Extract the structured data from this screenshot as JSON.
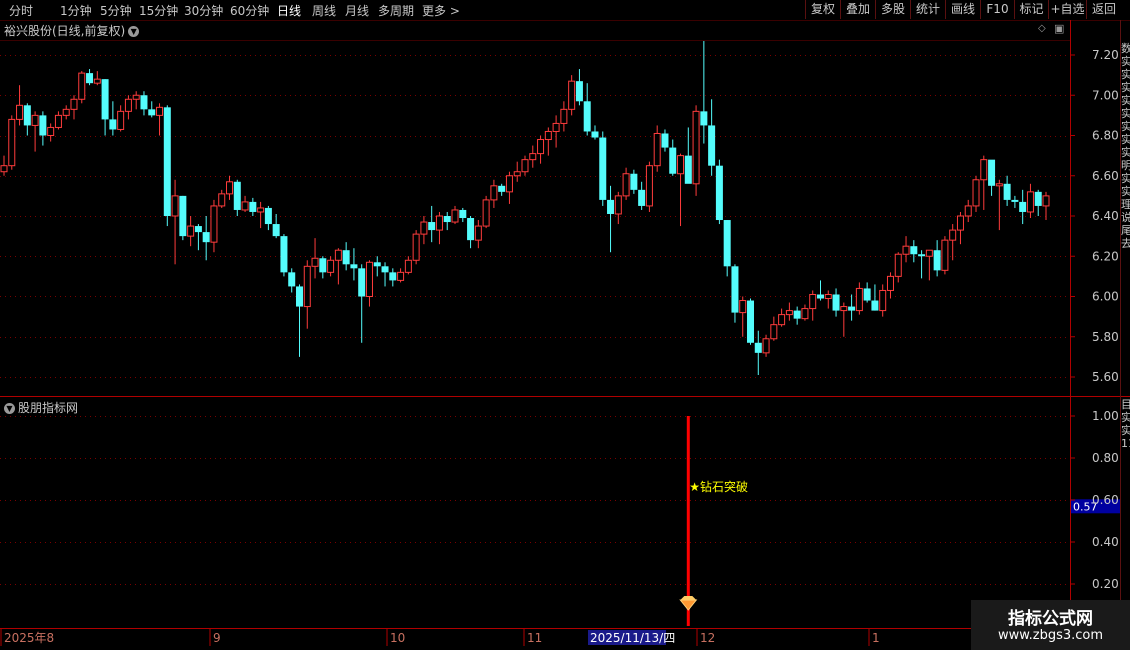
{
  "toolbar": {
    "periods": [
      "分时",
      "1分钟",
      "5分钟",
      "15分钟",
      "30分钟",
      "60分钟",
      "日线",
      "周线",
      "月线",
      "多周期",
      "更多"
    ],
    "active_period": "日线",
    "more_chevron": "chevron-right-icon",
    "buttons": [
      "复权",
      "叠加",
      "多股",
      "统计",
      "画线",
      "F10",
      "标记",
      "+自选",
      "返回"
    ]
  },
  "stock_title": "裕兴股份(日线,前复权)",
  "indicator_title": "股朋指标网",
  "current_value": "0.57",
  "signal_label": "★钻石突破",
  "date_labels": [
    "2025年8",
    "9",
    "10",
    "11",
    "2025/11/13/四",
    "12",
    "1"
  ],
  "right_column_glyphs": "数实实实实实实实实明实实理说尾去",
  "right_column_glyphs_lower": "目实实1111",
  "watermark": {
    "line1": "指标公式网",
    "line2": "www.zbgs3.com"
  },
  "colors": {
    "up": "#ff3c3c",
    "down": "#54fcfc",
    "grid": "#7a0000",
    "signal": "#ff0000",
    "label": "#ffff00",
    "value_box": "#0000a0"
  },
  "chart_data": [
    {
      "type": "candlestick",
      "title": "裕兴股份(日线,前复权)",
      "y_ticks": [
        "7.20",
        "7.00",
        "6.80",
        "6.60",
        "6.40",
        "6.20",
        "6.00",
        "5.80",
        "5.60"
      ],
      "ylim": [
        5.55,
        7.28
      ],
      "grid": true,
      "ohlc": [
        [
          6.62,
          6.7,
          6.6,
          6.65
        ],
        [
          6.65,
          6.9,
          6.63,
          6.88
        ],
        [
          6.88,
          7.05,
          6.85,
          6.95
        ],
        [
          6.95,
          6.96,
          6.8,
          6.85
        ],
        [
          6.85,
          6.92,
          6.72,
          6.9
        ],
        [
          6.9,
          6.92,
          6.75,
          6.8
        ],
        [
          6.8,
          6.86,
          6.77,
          6.84
        ],
        [
          6.84,
          6.92,
          6.83,
          6.9
        ],
        [
          6.9,
          6.95,
          6.88,
          6.93
        ],
        [
          6.93,
          7.0,
          6.88,
          6.98
        ],
        [
          6.98,
          7.12,
          6.96,
          7.11
        ],
        [
          7.11,
          7.13,
          7.05,
          7.06
        ],
        [
          7.06,
          7.12,
          7.05,
          7.08
        ],
        [
          7.08,
          7.08,
          6.8,
          6.88
        ],
        [
          6.88,
          6.97,
          6.8,
          6.83
        ],
        [
          6.83,
          6.95,
          6.82,
          6.92
        ],
        [
          6.92,
          7.0,
          6.88,
          6.98
        ],
        [
          6.98,
          7.02,
          6.93,
          7.0
        ],
        [
          7.0,
          7.02,
          6.9,
          6.93
        ],
        [
          6.93,
          6.97,
          6.89,
          6.9
        ],
        [
          6.9,
          6.96,
          6.8,
          6.94
        ],
        [
          6.94,
          6.95,
          6.35,
          6.4
        ],
        [
          6.4,
          6.58,
          6.16,
          6.5
        ],
        [
          6.5,
          6.5,
          6.28,
          6.3
        ],
        [
          6.3,
          6.4,
          6.25,
          6.35
        ],
        [
          6.35,
          6.36,
          6.23,
          6.32
        ],
        [
          6.32,
          6.4,
          6.18,
          6.27
        ],
        [
          6.27,
          6.48,
          6.22,
          6.45
        ],
        [
          6.45,
          6.53,
          6.44,
          6.51
        ],
        [
          6.51,
          6.6,
          6.48,
          6.57
        ],
        [
          6.57,
          6.58,
          6.4,
          6.43
        ],
        [
          6.43,
          6.5,
          6.42,
          6.47
        ],
        [
          6.47,
          6.49,
          6.4,
          6.42
        ],
        [
          6.42,
          6.47,
          6.34,
          6.44
        ],
        [
          6.44,
          6.45,
          6.33,
          6.36
        ],
        [
          6.36,
          6.41,
          6.29,
          6.3
        ],
        [
          6.3,
          6.31,
          6.1,
          6.12
        ],
        [
          6.12,
          6.14,
          6.02,
          6.05
        ],
        [
          6.05,
          6.06,
          5.7,
          5.95
        ],
        [
          5.95,
          6.18,
          5.84,
          6.15
        ],
        [
          6.15,
          6.29,
          6.09,
          6.19
        ],
        [
          6.19,
          6.2,
          6.09,
          6.12
        ],
        [
          6.12,
          6.2,
          6.1,
          6.18
        ],
        [
          6.18,
          6.24,
          6.06,
          6.23
        ],
        [
          6.23,
          6.27,
          6.13,
          6.16
        ],
        [
          6.16,
          6.24,
          6.08,
          6.14
        ],
        [
          6.14,
          6.16,
          5.77,
          6.0
        ],
        [
          6.0,
          6.18,
          5.95,
          6.17
        ],
        [
          6.17,
          6.2,
          6.1,
          6.15
        ],
        [
          6.15,
          6.17,
          6.05,
          6.12
        ],
        [
          6.12,
          6.14,
          6.05,
          6.08
        ],
        [
          6.08,
          6.14,
          6.07,
          6.12
        ],
        [
          6.12,
          6.2,
          6.11,
          6.18
        ],
        [
          6.18,
          6.33,
          6.16,
          6.31
        ],
        [
          6.31,
          6.4,
          6.26,
          6.37
        ],
        [
          6.37,
          6.45,
          6.27,
          6.33
        ],
        [
          6.33,
          6.42,
          6.26,
          6.4
        ],
        [
          6.4,
          6.42,
          6.33,
          6.37
        ],
        [
          6.37,
          6.45,
          6.36,
          6.43
        ],
        [
          6.43,
          6.44,
          6.37,
          6.39
        ],
        [
          6.39,
          6.4,
          6.24,
          6.28
        ],
        [
          6.28,
          6.38,
          6.24,
          6.35
        ],
        [
          6.35,
          6.5,
          6.34,
          6.48
        ],
        [
          6.48,
          6.58,
          6.44,
          6.55
        ],
        [
          6.55,
          6.56,
          6.5,
          6.52
        ],
        [
          6.52,
          6.62,
          6.46,
          6.6
        ],
        [
          6.6,
          6.67,
          6.57,
          6.62
        ],
        [
          6.62,
          6.7,
          6.6,
          6.68
        ],
        [
          6.68,
          6.75,
          6.64,
          6.71
        ],
        [
          6.71,
          6.8,
          6.66,
          6.78
        ],
        [
          6.78,
          6.84,
          6.7,
          6.82
        ],
        [
          6.82,
          6.9,
          6.74,
          6.86
        ],
        [
          6.86,
          6.97,
          6.82,
          6.93
        ],
        [
          6.93,
          7.1,
          6.9,
          7.07
        ],
        [
          7.07,
          7.13,
          6.95,
          6.97
        ],
        [
          6.97,
          7.06,
          6.8,
          6.82
        ],
        [
          6.82,
          6.85,
          6.78,
          6.79
        ],
        [
          6.79,
          6.82,
          6.45,
          6.48
        ],
        [
          6.48,
          6.55,
          6.22,
          6.41
        ],
        [
          6.41,
          6.52,
          6.36,
          6.5
        ],
        [
          6.5,
          6.64,
          6.48,
          6.61
        ],
        [
          6.61,
          6.63,
          6.51,
          6.53
        ],
        [
          6.53,
          6.57,
          6.43,
          6.45
        ],
        [
          6.45,
          6.67,
          6.42,
          6.65
        ],
        [
          6.65,
          6.85,
          6.62,
          6.81
        ],
        [
          6.81,
          6.83,
          6.72,
          6.74
        ],
        [
          6.74,
          6.78,
          6.6,
          6.61
        ],
        [
          6.61,
          6.71,
          6.35,
          6.7
        ],
        [
          6.7,
          6.84,
          6.62,
          6.56
        ],
        [
          6.56,
          6.95,
          6.5,
          6.92
        ],
        [
          6.92,
          7.27,
          6.76,
          6.85
        ],
        [
          6.85,
          6.98,
          6.6,
          6.65
        ],
        [
          6.65,
          6.68,
          6.36,
          6.38
        ],
        [
          6.38,
          6.38,
          6.1,
          6.15
        ],
        [
          6.15,
          6.16,
          5.87,
          5.92
        ],
        [
          5.92,
          6.0,
          5.8,
          5.98
        ],
        [
          5.98,
          5.99,
          5.76,
          5.77
        ],
        [
          5.77,
          5.83,
          5.61,
          5.72
        ],
        [
          5.72,
          5.81,
          5.7,
          5.79
        ],
        [
          5.79,
          5.9,
          5.78,
          5.86
        ],
        [
          5.86,
          5.94,
          5.85,
          5.91
        ],
        [
          5.91,
          5.97,
          5.88,
          5.93
        ],
        [
          5.93,
          5.95,
          5.86,
          5.89
        ],
        [
          5.89,
          5.96,
          5.88,
          5.94
        ],
        [
          5.94,
          6.03,
          5.88,
          6.01
        ],
        [
          6.01,
          6.08,
          5.98,
          5.99
        ],
        [
          5.99,
          6.03,
          5.94,
          6.01
        ],
        [
          6.01,
          6.04,
          5.9,
          5.93
        ],
        [
          5.93,
          5.97,
          5.8,
          5.95
        ],
        [
          5.95,
          6.01,
          5.88,
          5.93
        ],
        [
          5.93,
          6.07,
          5.91,
          6.04
        ],
        [
          6.04,
          6.07,
          5.97,
          5.98
        ],
        [
          5.98,
          6.06,
          5.93,
          5.93
        ],
        [
          5.93,
          6.06,
          5.9,
          6.03
        ],
        [
          6.03,
          6.12,
          5.99,
          6.1
        ],
        [
          6.1,
          6.22,
          6.07,
          6.21
        ],
        [
          6.21,
          6.3,
          6.17,
          6.25
        ],
        [
          6.25,
          6.28,
          6.17,
          6.21
        ],
        [
          6.21,
          6.23,
          6.09,
          6.2
        ],
        [
          6.2,
          6.23,
          6.08,
          6.23
        ],
        [
          6.23,
          6.28,
          6.1,
          6.13
        ],
        [
          6.13,
          6.3,
          6.11,
          6.28
        ],
        [
          6.28,
          6.36,
          6.18,
          6.33
        ],
        [
          6.33,
          6.42,
          6.26,
          6.4
        ],
        [
          6.4,
          6.48,
          6.37,
          6.45
        ],
        [
          6.45,
          6.6,
          6.42,
          6.58
        ],
        [
          6.58,
          6.7,
          6.43,
          6.68
        ],
        [
          6.68,
          6.62,
          6.5,
          6.55
        ],
        [
          6.55,
          6.58,
          6.33,
          6.56
        ],
        [
          6.56,
          6.6,
          6.45,
          6.48
        ],
        [
          6.48,
          6.5,
          6.44,
          6.47
        ],
        [
          6.47,
          6.53,
          6.36,
          6.42
        ],
        [
          6.42,
          6.56,
          6.39,
          6.52
        ],
        [
          6.52,
          6.53,
          6.4,
          6.45
        ],
        [
          6.45,
          6.52,
          6.38,
          6.5
        ]
      ]
    },
    {
      "type": "line",
      "title": "股朋指标网",
      "y_ticks": [
        "1.00",
        "0.80",
        "0.60",
        "0.40",
        "0.20"
      ],
      "ylim": [
        0.0,
        1.05
      ],
      "current_value": 0.57,
      "signal_index": 88,
      "signal_value": 1.0,
      "signal_label": "★钻石突破"
    }
  ]
}
